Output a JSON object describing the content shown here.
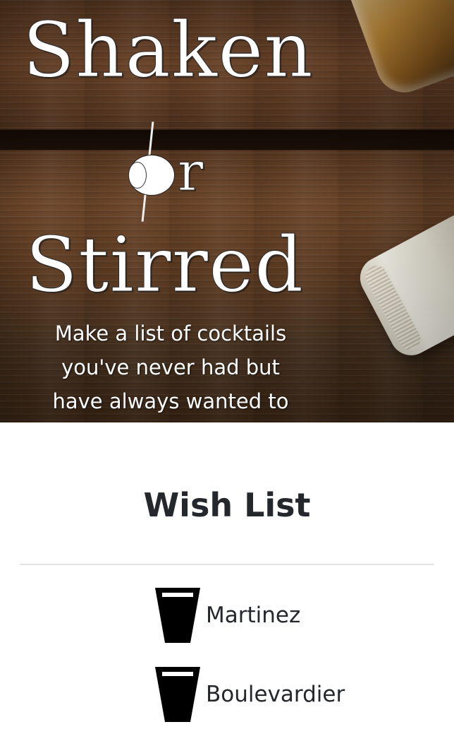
{
  "hero": {
    "title_line_1": "Shaken",
    "title_line_2_letters": "r",
    "title_line_3": "Stirred",
    "tagline_line_1": "Make a list of cocktails",
    "tagline_line_2": "you've never had but",
    "tagline_line_3": "have always wanted to"
  },
  "wishlist": {
    "title": "Wish List",
    "items": [
      {
        "label": "Martinez",
        "icon": "cup-icon"
      },
      {
        "label": "Boulevardier",
        "icon": "cup-icon"
      }
    ]
  },
  "colors": {
    "text": "#24272c",
    "divider": "#e3e3e3",
    "wood": "#5b3a22"
  }
}
